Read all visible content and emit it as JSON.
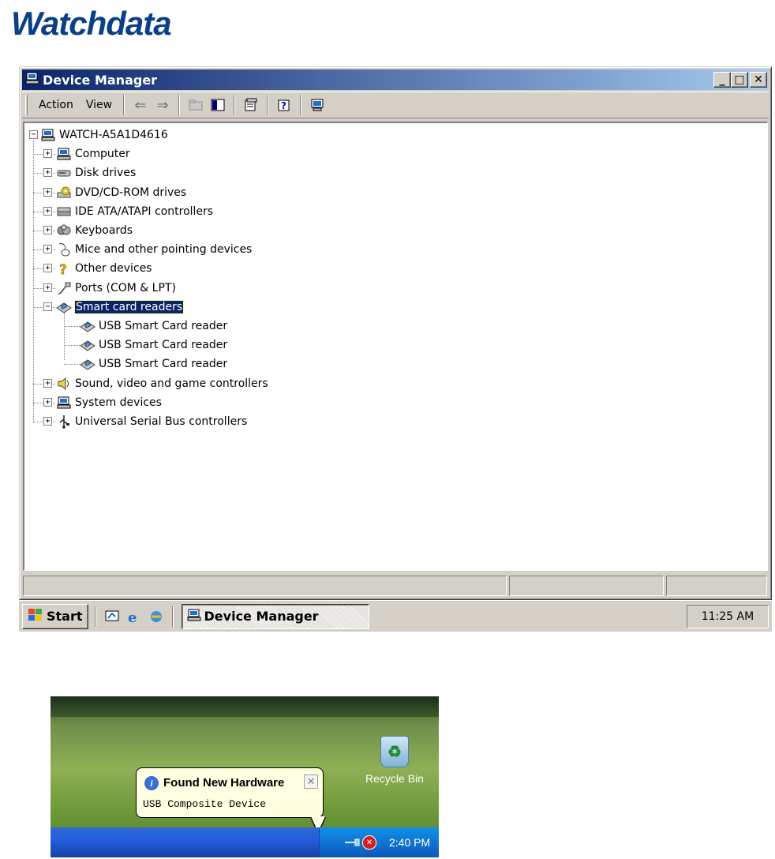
{
  "logo": {
    "text": "Watchdata"
  },
  "window": {
    "title": "Device Manager",
    "buttons": {
      "minimize": "_",
      "maximize": "□",
      "close": "✕"
    }
  },
  "menu": {
    "action": "Action",
    "view": "View"
  },
  "tree": {
    "root": "WATCH-A5A1D4616",
    "categories": [
      "Computer",
      "Disk drives",
      "DVD/CD-ROM drives",
      "IDE ATA/ATAPI controllers",
      "Keyboards",
      "Mice and other pointing devices",
      "Other devices",
      "Ports (COM & LPT)",
      "Smart card readers",
      "Sound, video and game controllers",
      "System devices",
      "Universal Serial Bus controllers"
    ],
    "smart_card_children": [
      "USB Smart Card reader",
      "USB Smart Card reader",
      "USB Smart Card reader"
    ]
  },
  "taskbar": {
    "start": "Start",
    "task": "Device Manager",
    "clock": "11:25 AM"
  },
  "xp": {
    "recycle_bin": "Recycle Bin",
    "balloon_title": "Found New Hardware",
    "balloon_text": "USB Composite Device",
    "clock": "2:40 PM"
  }
}
